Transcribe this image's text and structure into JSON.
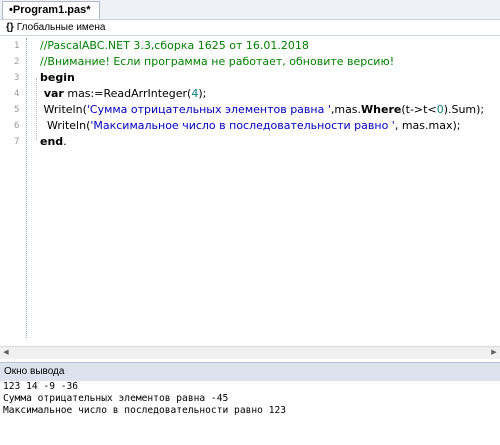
{
  "tab": {
    "label": "•Program1.pas*"
  },
  "scope_bar": {
    "icon": "{}",
    "label": "Глобальные имена"
  },
  "editor": {
    "line_numbers": [
      "1",
      "2",
      "3",
      "4",
      "5",
      "6",
      "7"
    ],
    "lines": [
      [
        {
          "t": "//PascalABC.NET 3.3,сборка 1625 от 16.01.2018",
          "c": "cmt"
        }
      ],
      [
        {
          "t": "//Внимание! Если программа не работает, обновите версию!",
          "c": "cmt"
        }
      ],
      [
        {
          "t": "begin",
          "c": "kw"
        }
      ],
      [
        {
          "t": " var",
          "c": "kw"
        },
        {
          "t": " mas:=ReadArrInteger(",
          "c": ""
        },
        {
          "t": "4",
          "c": "num"
        },
        {
          "t": ");",
          "c": ""
        }
      ],
      [
        {
          "t": " Writeln(",
          "c": ""
        },
        {
          "t": "'Сумма отрицательных элементов равна '",
          "c": "str"
        },
        {
          "t": ",mas.",
          "c": ""
        },
        {
          "t": "Where",
          "c": "kw"
        },
        {
          "t": "(t->t<",
          "c": ""
        },
        {
          "t": "0",
          "c": "num"
        },
        {
          "t": ").Sum);",
          "c": ""
        }
      ],
      [
        {
          "t": "  Writeln(",
          "c": ""
        },
        {
          "t": "'Максимальное число в последовательности равно '",
          "c": "str"
        },
        {
          "t": ", mas.max);",
          "c": ""
        }
      ],
      [
        {
          "t": "end",
          "c": "kw"
        },
        {
          "t": ".",
          "c": ""
        }
      ]
    ]
  },
  "output": {
    "title": "Окно вывода",
    "lines": [
      "123 14 -9 -36",
      "Сумма отрицательных элементов равна -45",
      "Максимальное число в последовательности равно 123"
    ]
  },
  "scrollbar": {
    "left_arrow": "◀",
    "right_arrow": "▶"
  }
}
